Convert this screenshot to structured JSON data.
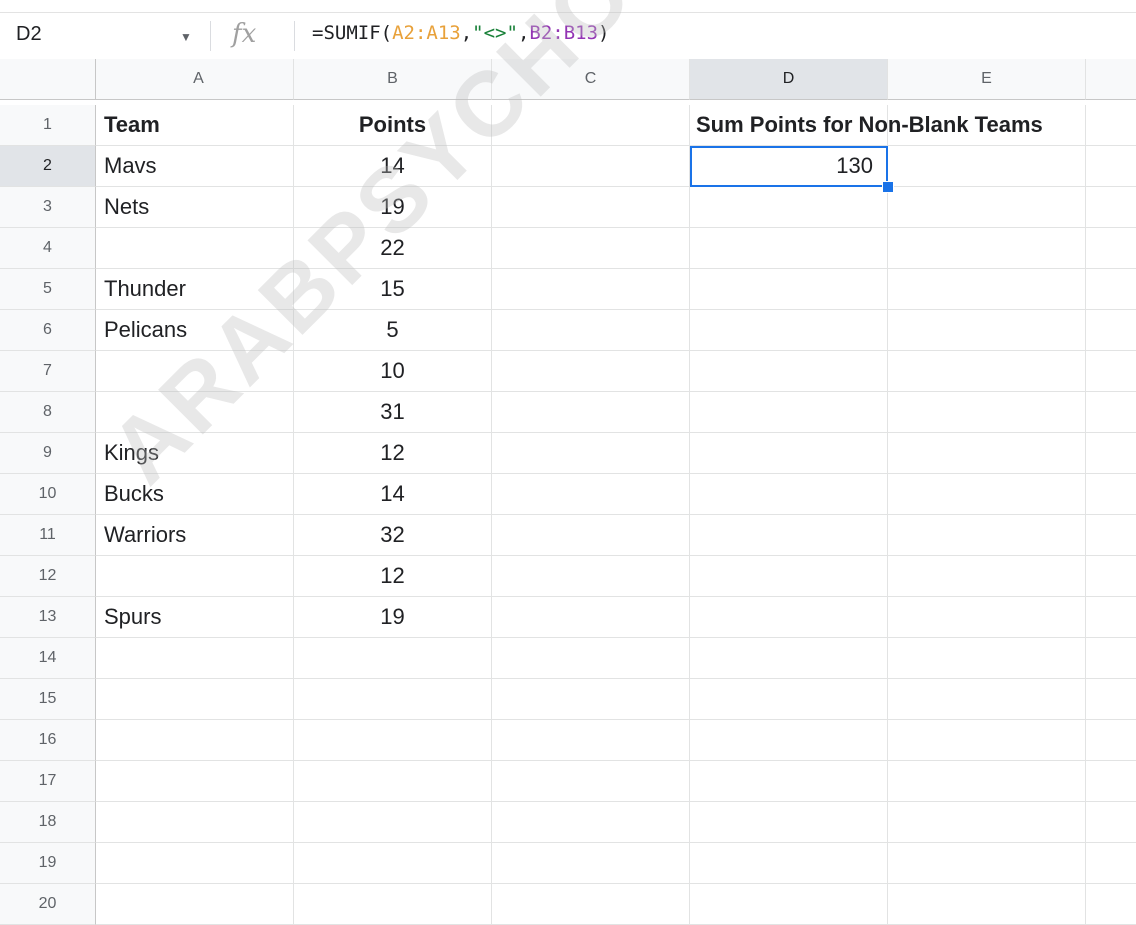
{
  "formula_bar": {
    "name_box": "D2",
    "dropdown_icon": "caret-down-icon",
    "fx_icon": "fx",
    "formula_parts": [
      "=SUMIF(",
      "A2:A13",
      ",",
      "\"<>\"",
      ",",
      "B2:B13",
      ")"
    ]
  },
  "columns": [
    "A",
    "B",
    "C",
    "D",
    "E"
  ],
  "rows": [
    {
      "num": "1",
      "A": "Team",
      "B": "Points",
      "D": "Sum Points for Non-Blank Teams"
    },
    {
      "num": "2",
      "A": "Mavs",
      "B": "14",
      "D": "130"
    },
    {
      "num": "3",
      "A": "Nets",
      "B": "19"
    },
    {
      "num": "4",
      "A": "",
      "B": "22"
    },
    {
      "num": "5",
      "A": "Thunder",
      "B": "15"
    },
    {
      "num": "6",
      "A": "Pelicans",
      "B": "5"
    },
    {
      "num": "7",
      "A": "",
      "B": "10"
    },
    {
      "num": "8",
      "A": "",
      "B": "31"
    },
    {
      "num": "9",
      "A": "Kings",
      "B": "12"
    },
    {
      "num": "10",
      "A": "Bucks",
      "B": "14"
    },
    {
      "num": "11",
      "A": "Warriors",
      "B": "32"
    },
    {
      "num": "12",
      "A": "",
      "B": "12"
    },
    {
      "num": "13",
      "A": "Spurs",
      "B": "19"
    },
    {
      "num": "14"
    },
    {
      "num": "15"
    },
    {
      "num": "16"
    },
    {
      "num": "17"
    },
    {
      "num": "18"
    },
    {
      "num": "19"
    },
    {
      "num": "20"
    }
  ],
  "selection": {
    "column": "D",
    "row": "2"
  },
  "colors": {
    "accent": "#1a73e8",
    "range1": "#e8a13a",
    "string": "#188038",
    "range2": "#9334b4"
  },
  "watermark": "ARABPSYCHOLOGY.C"
}
